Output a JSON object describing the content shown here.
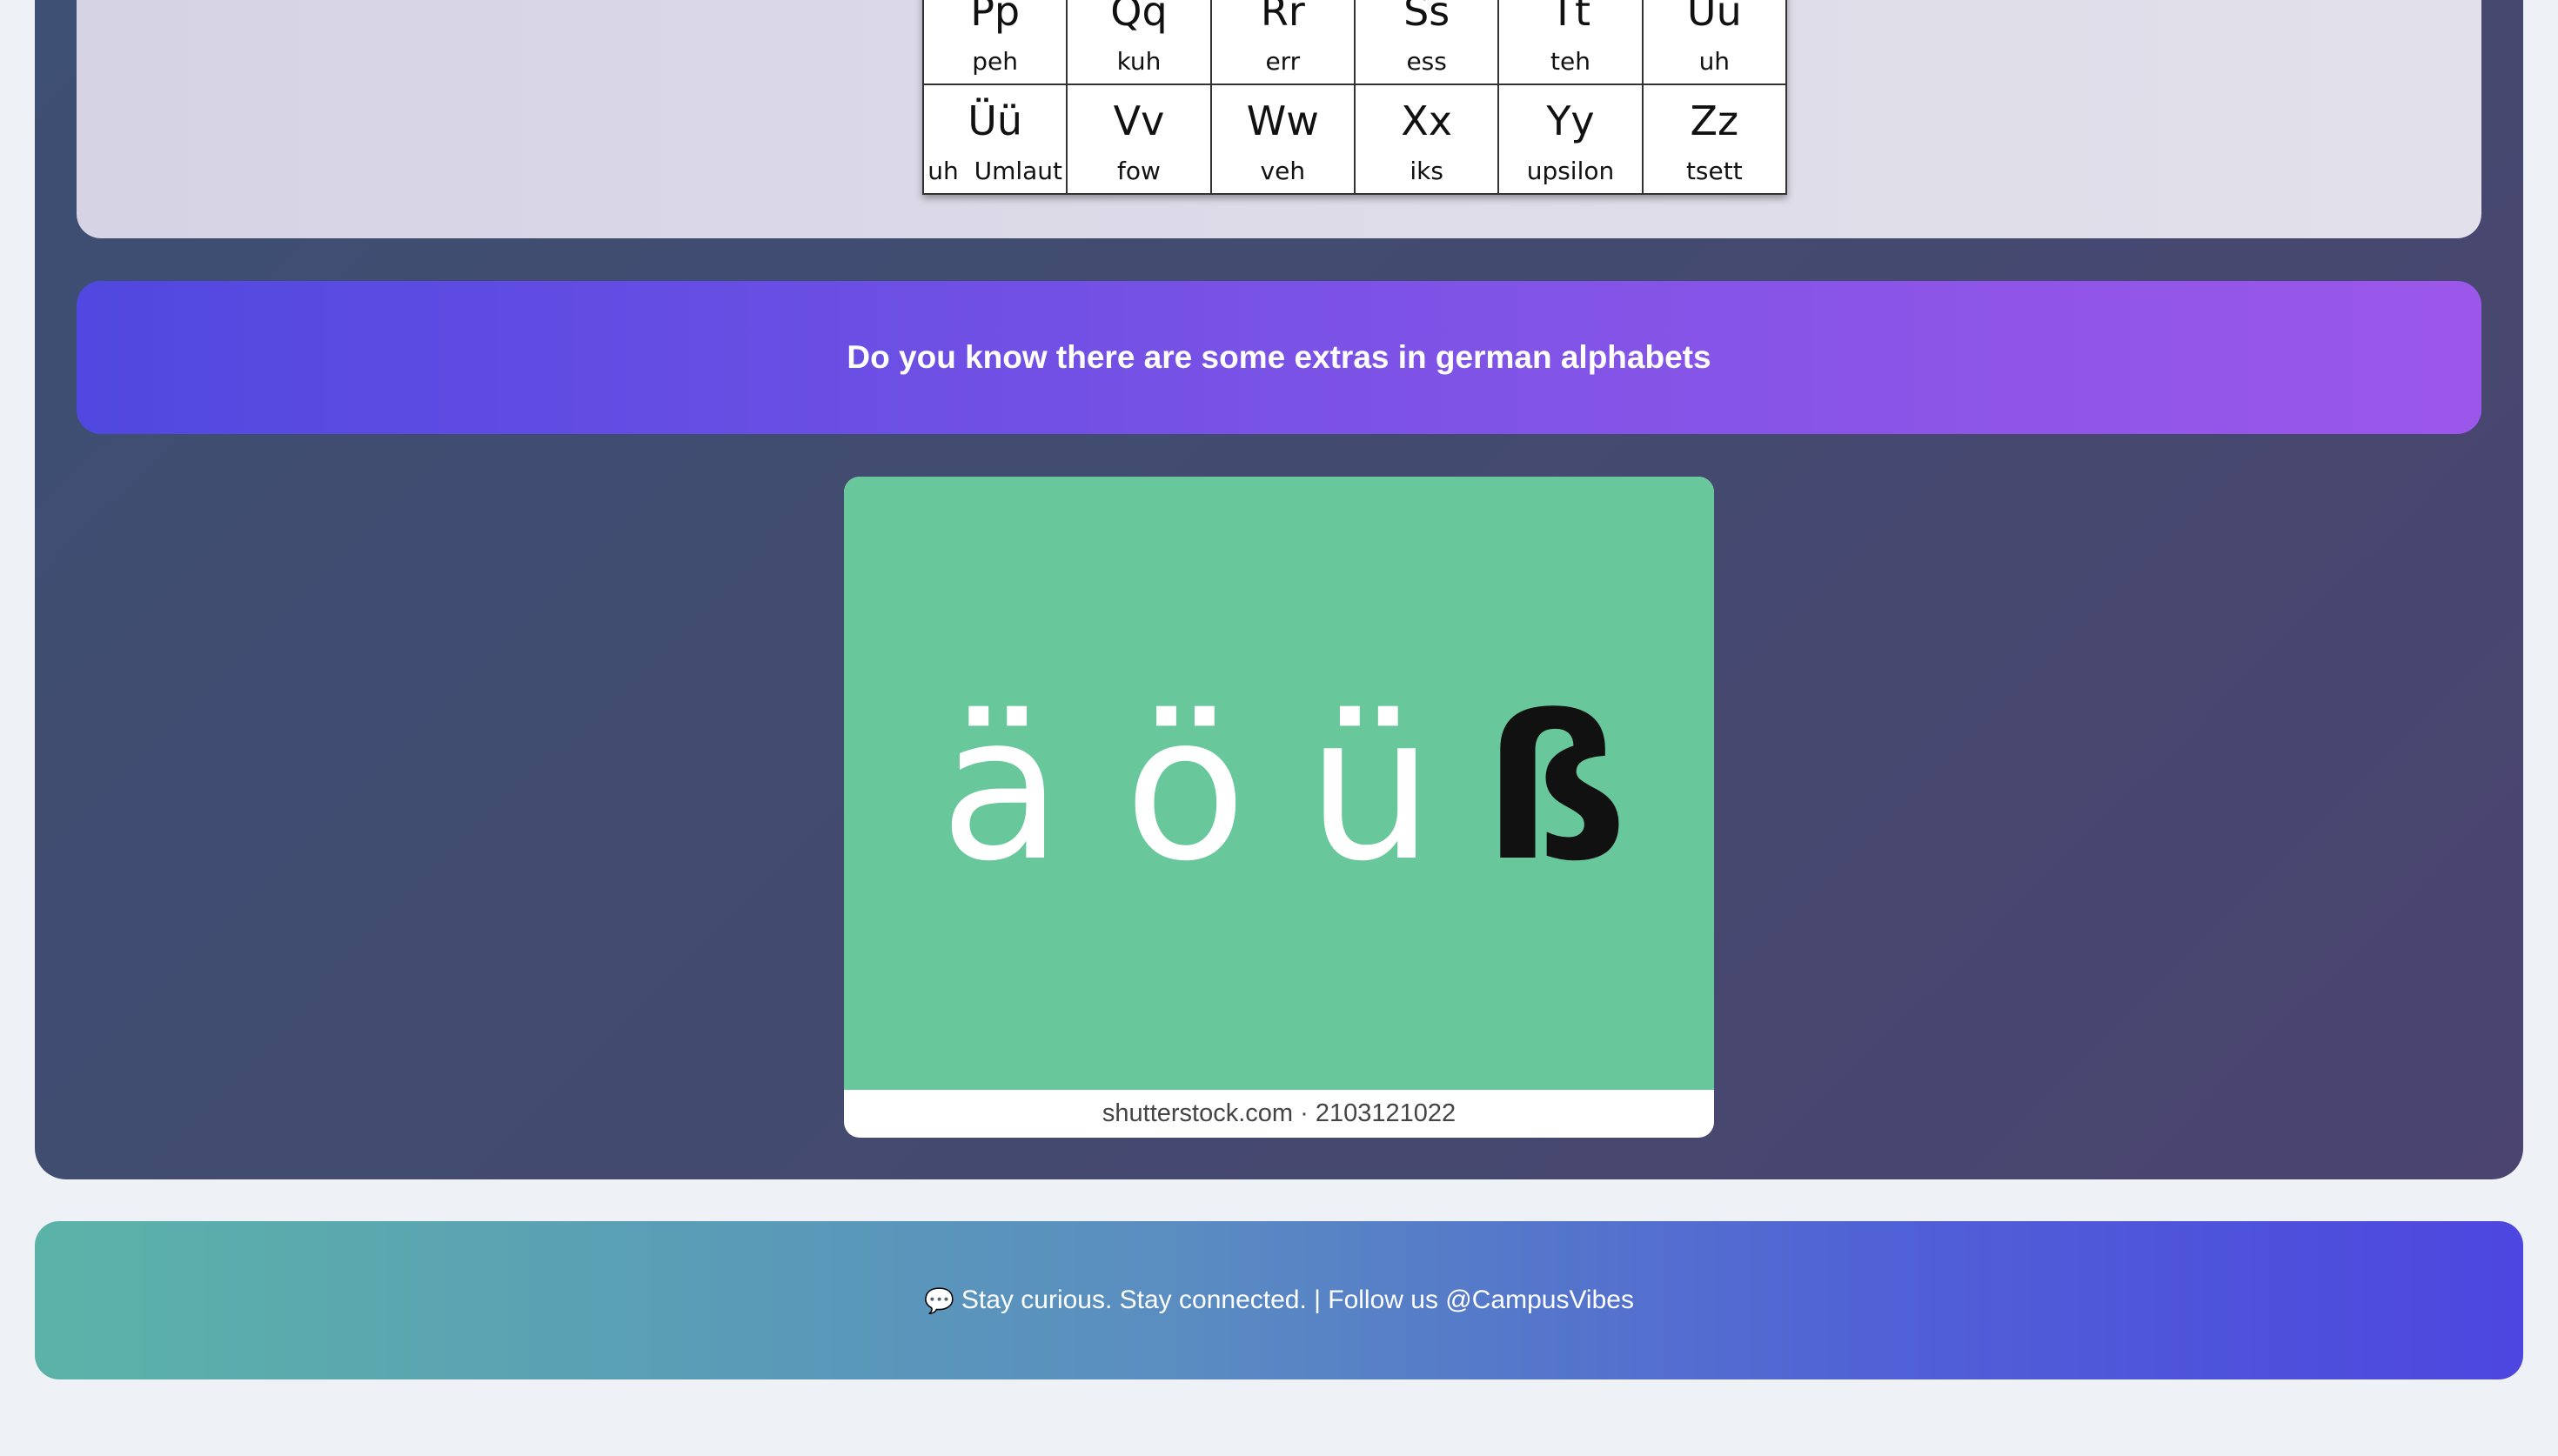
{
  "alphabet_chart": {
    "rows": [
      [
        {
          "letter": "Pp",
          "pron": "peh"
        },
        {
          "letter": "Qq",
          "pron": "kuh"
        },
        {
          "letter": "Rr",
          "pron": "err"
        },
        {
          "letter": "Ss",
          "pron": "ess"
        },
        {
          "letter": "Tt",
          "pron": "teh"
        },
        {
          "letter": "Uu",
          "pron": "uh"
        }
      ],
      [
        {
          "letter": "Üü",
          "pron": "uh  Umlaut"
        },
        {
          "letter": "Vv",
          "pron": "fow"
        },
        {
          "letter": "Ww",
          "pron": "veh"
        },
        {
          "letter": "Xx",
          "pron": "iks"
        },
        {
          "letter": "Yy",
          "pron": "upsilon"
        },
        {
          "letter": "Zz",
          "pron": "tsett"
        }
      ]
    ]
  },
  "banner": {
    "text": "Do you know there are some extras in german alphabets"
  },
  "umlaut_image": {
    "glyphs": [
      "ä",
      "ö",
      "ü",
      "ß"
    ],
    "caption": "shutterstock.com · 2103121022",
    "background_color": "#68c89b"
  },
  "footer": {
    "icon": "speech-bubble-icon",
    "icon_glyph": "💬",
    "text": "Stay curious. Stay connected. | Follow us @CampusVibes"
  }
}
